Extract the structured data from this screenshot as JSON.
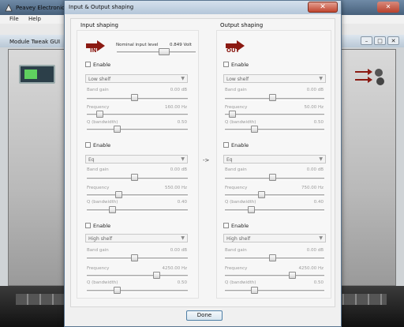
{
  "background_app": {
    "title": "Peavey Electronic",
    "menu": [
      "File",
      "Help"
    ],
    "subwindow_title": "Module Tweak GUI",
    "close_label": "✕",
    "subwindow_buttons": [
      "–",
      "□",
      "✕"
    ]
  },
  "dialog": {
    "title": "Input & Output shaping",
    "close_label": "✕",
    "done_label": "Done",
    "mid_arrow": "->"
  },
  "input": {
    "title": "Input shaping",
    "icon_label": "IN",
    "nominal_label": "Nominal input level",
    "nominal_value": "0.849 Volt",
    "bands": [
      {
        "enable_label": "Enable",
        "type": "Low shelf",
        "gain_label": "Band gain",
        "gain_value": "0.00 dB",
        "freq_label": "Frequency",
        "freq_value": "160.00 Hz",
        "q_label": "Q (bandwidth)",
        "q_value": "0.50"
      },
      {
        "enable_label": "Enable",
        "type": "Eq",
        "gain_label": "Band gain",
        "gain_value": "0.00 dB",
        "freq_label": "Frequency",
        "freq_value": "550.00 Hz",
        "q_label": "Q (bandwidth)",
        "q_value": "0.40"
      },
      {
        "enable_label": "Enable",
        "type": "High shelf",
        "gain_label": "Band gain",
        "gain_value": "0.00 dB",
        "freq_label": "Frequency",
        "freq_value": "4250.00 Hz",
        "q_label": "Q (bandwidth)",
        "q_value": "0.50"
      }
    ]
  },
  "output": {
    "title": "Output shaping",
    "icon_label": "OUT",
    "bands": [
      {
        "enable_label": "Enable",
        "type": "Low shelf",
        "gain_label": "Band gain",
        "gain_value": "0.00 dB",
        "freq_label": "Frequency",
        "freq_value": "50.00 Hz",
        "q_label": "Q (bandwidth)",
        "q_value": "0.50"
      },
      {
        "enable_label": "Enable",
        "type": "Eq",
        "gain_label": "Band gain",
        "gain_value": "0.00 dB",
        "freq_label": "Frequency",
        "freq_value": "750.00 Hz",
        "q_label": "Q (bandwidth)",
        "q_value": "0.40"
      },
      {
        "enable_label": "Enable",
        "type": "High shelf",
        "gain_label": "Band gain",
        "gain_value": "0.00 dB",
        "freq_label": "Frequency",
        "freq_value": "4250.00 Hz",
        "q_label": "Q (bandwidth)",
        "q_value": "0.50"
      }
    ]
  },
  "colors": {
    "arrow_red": "#8b1a12",
    "title_bar": "#c4d4e4",
    "close_red": "#c0452f"
  }
}
